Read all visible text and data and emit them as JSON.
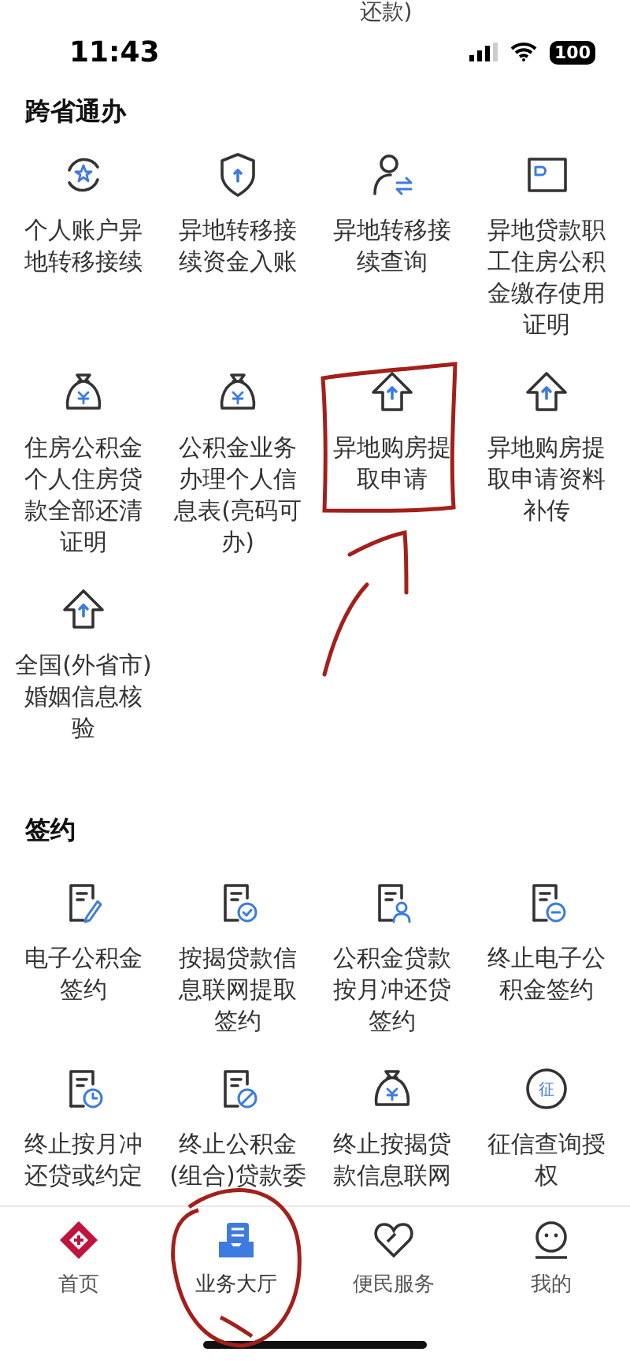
{
  "top_cut_text": "还款)",
  "status_bar": {
    "time": "11:43",
    "battery": "100"
  },
  "sections": [
    {
      "title": "跨省通办",
      "items": [
        {
          "label": "个人账户异地转移接续"
        },
        {
          "label": "异地转移接续资金入账"
        },
        {
          "label": "异地转移接续查询"
        },
        {
          "label": "异地贷款职工住房公积金缴存使用证明"
        },
        {
          "label": "住房公积金个人住房贷款全部还清证明"
        },
        {
          "label": "公积金业务办理个人信息表(亮码可办)"
        },
        {
          "label": "异地购房提取申请"
        },
        {
          "label": "异地购房提取申请资料补传"
        },
        {
          "label": "全国(外省市)婚姻信息核验"
        }
      ]
    },
    {
      "title": "签约",
      "items": [
        {
          "label": "电子公积金签约"
        },
        {
          "label": "按揭贷款信息联网提取签约"
        },
        {
          "label": "公积金贷款按月冲还贷签约"
        },
        {
          "label": "终止电子公积金签约"
        },
        {
          "label": "终止按月冲还贷或约定"
        },
        {
          "label": "终止公积金(组合)贷款委"
        },
        {
          "label": "终止按揭贷款信息联网"
        },
        {
          "label": "征信查询授权",
          "icon_text": "征"
        }
      ]
    }
  ],
  "tabs": [
    {
      "label": "首页",
      "selected": false
    },
    {
      "label": "业务大厅",
      "selected": true
    },
    {
      "label": "便民服务",
      "selected": false
    },
    {
      "label": "我的",
      "selected": false
    }
  ]
}
